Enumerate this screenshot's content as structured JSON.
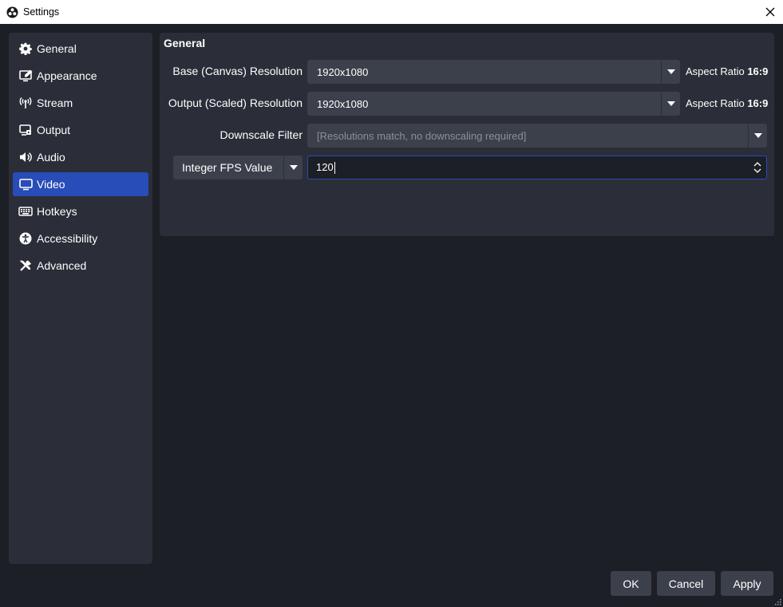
{
  "window": {
    "title": "Settings"
  },
  "sidebar": {
    "items": [
      {
        "label": "General",
        "icon": "gear-icon"
      },
      {
        "label": "Appearance",
        "icon": "appearance-icon"
      },
      {
        "label": "Stream",
        "icon": "broadcast-icon"
      },
      {
        "label": "Output",
        "icon": "output-icon"
      },
      {
        "label": "Audio",
        "icon": "speaker-icon"
      },
      {
        "label": "Video",
        "icon": "monitor-icon",
        "active": true
      },
      {
        "label": "Hotkeys",
        "icon": "keyboard-icon"
      },
      {
        "label": "Accessibility",
        "icon": "accessibility-icon"
      },
      {
        "label": "Advanced",
        "icon": "tools-icon"
      }
    ]
  },
  "video": {
    "section_title": "General",
    "base_resolution": {
      "label": "Base (Canvas) Resolution",
      "value": "1920x1080",
      "aspect_prefix": "Aspect Ratio",
      "aspect_value": "16:9"
    },
    "output_resolution": {
      "label": "Output (Scaled) Resolution",
      "value": "1920x1080",
      "aspect_prefix": "Aspect Ratio",
      "aspect_value": "16:9"
    },
    "downscale_filter": {
      "label": "Downscale Filter",
      "value": "[Resolutions match, no downscaling required]"
    },
    "fps": {
      "type_value": "Integer FPS Value",
      "value": "120"
    }
  },
  "footer": {
    "ok": "OK",
    "cancel": "Cancel",
    "apply": "Apply"
  },
  "colors": {
    "accent": "#284cb8",
    "background": "#1d1f26",
    "panel": "#2b2e38",
    "control": "#3c404b"
  }
}
